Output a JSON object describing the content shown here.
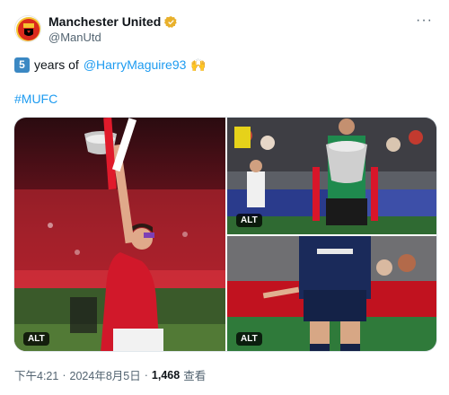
{
  "colors": {
    "accent": "#1d9bf0",
    "verified": "#e8b02b",
    "text": "#0f1419",
    "secondary": "#536471"
  },
  "author": {
    "display_name": "Manchester United",
    "handle": "@ManUtd",
    "verified_icon": "gold-verified-badge-icon",
    "avatar_icon": "man-utd-crest-icon"
  },
  "more_label": "···",
  "tweet": {
    "keycap": "5",
    "text_before": "years of",
    "mention": "@HarryMaguire93",
    "emoji": "🙌",
    "hashtag": "#MUFC"
  },
  "media": {
    "images": [
      {
        "alt_label": "ALT"
      },
      {
        "alt_label": "ALT"
      },
      {
        "alt_label": "ALT"
      }
    ]
  },
  "meta": {
    "time": "下午4:21",
    "dot": "·",
    "date": "2024年8月5日",
    "views_count": "1,468",
    "views_label": "查看"
  }
}
